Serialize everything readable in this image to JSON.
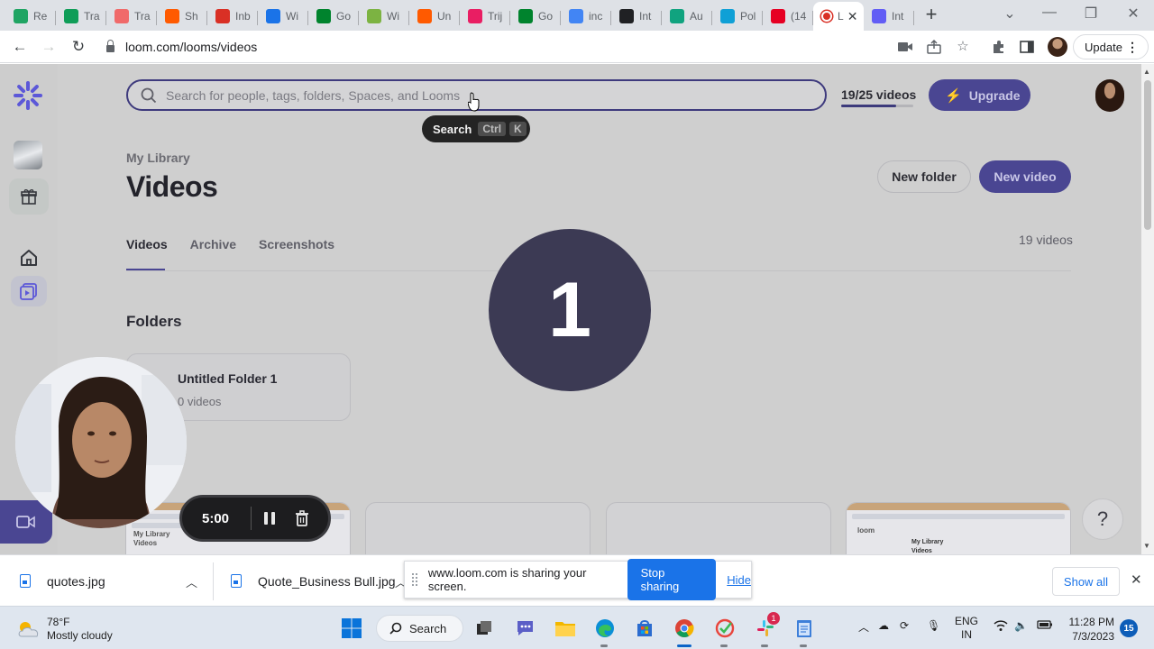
{
  "browser": {
    "tabs": [
      {
        "label": "Re",
        "icon": "google-drive-icon",
        "color": "#1fa463"
      },
      {
        "label": "Tra",
        "icon": "google-sheets-icon",
        "color": "#0f9d58"
      },
      {
        "label": "Tra",
        "icon": "asana-icon",
        "color": "#f06a6a"
      },
      {
        "label": "Sh",
        "icon": "slides-icon",
        "color": "#ff5a00"
      },
      {
        "label": "Inb",
        "icon": "gmail-icon",
        "color": "#d93025"
      },
      {
        "label": "Wi",
        "icon": "calendar-icon",
        "color": "#1a73e8"
      },
      {
        "label": "Go",
        "icon": "google-meet-icon",
        "color": "#00832d"
      },
      {
        "label": "Wi",
        "icon": "check-icon",
        "color": "#7cb342"
      },
      {
        "label": "Un",
        "icon": "orange-square-icon",
        "color": "#ff5a00"
      },
      {
        "label": "Trij",
        "icon": "tripadvisor-icon",
        "color": "#e91e63"
      },
      {
        "label": "Go",
        "icon": "google-meet-icon",
        "color": "#00832d"
      },
      {
        "label": "inc",
        "icon": "google-icon",
        "color": "#4285f4"
      },
      {
        "label": "Int",
        "icon": "openai-dark-icon",
        "color": "#202124"
      },
      {
        "label": "Au",
        "icon": "openai-icon",
        "color": "#10a37f"
      },
      {
        "label": "Pol",
        "icon": "m-icon",
        "color": "#0fa0d6"
      },
      {
        "label": "(14",
        "icon": "pinterest-icon",
        "color": "#e60023"
      },
      {
        "label": "L",
        "icon": "recording-icon",
        "color": "#d93025"
      },
      {
        "label": "Int",
        "icon": "loom-icon",
        "color": "#625df5"
      }
    ],
    "url": "loom.com/looms/videos",
    "update_label": "Update"
  },
  "app": {
    "search_placeholder": "Search for people, tags, folders, Spaces, and Looms",
    "tooltip_label": "Search",
    "tooltip_keys": [
      "Ctrl",
      "K"
    ],
    "quota_label": "19/25 videos",
    "quota_fraction": 0.76,
    "upgrade_label": "Upgrade",
    "breadcrumb": "My Library",
    "title": "Videos",
    "new_folder_label": "New folder",
    "new_video_label": "New video",
    "tabs": [
      "Videos",
      "Archive",
      "Screenshots"
    ],
    "active_tab": "Videos",
    "video_count": "19 videos",
    "folders_heading": "Folders",
    "folder": {
      "name": "Untitled Folder 1",
      "meta": "0 videos"
    },
    "countdown": "1",
    "help_label": "?",
    "thumb_text": {
      "a": "loom",
      "b": "My Library",
      "c": "Videos"
    }
  },
  "recorder": {
    "timer": "5:00"
  },
  "downloads": {
    "items": [
      "quotes.jpg",
      "Quote_Business Bull.jpg"
    ],
    "share_message": "www.loom.com is sharing your screen.",
    "stop_label": "Stop sharing",
    "hide_label": "Hide",
    "show_all_label": "Show all"
  },
  "taskbar": {
    "temperature": "78°F",
    "weather": "Mostly cloudy",
    "search_label": "Search",
    "lang_1": "ENG",
    "lang_2": "IN",
    "time": "11:28 PM",
    "date": "7/3/2023",
    "notifications": "15",
    "slack_badge": "1"
  }
}
